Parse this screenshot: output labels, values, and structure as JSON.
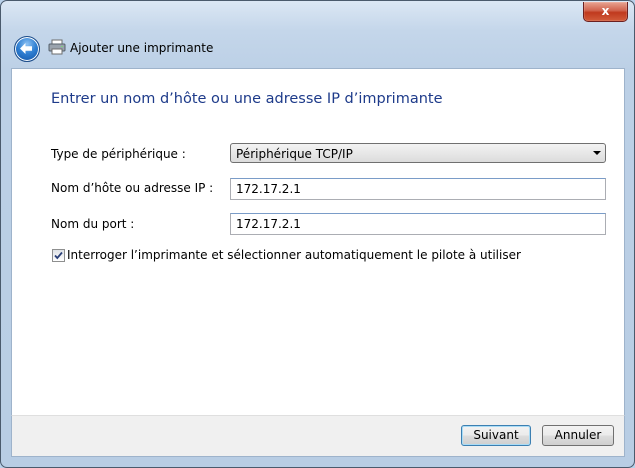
{
  "window": {
    "close_glyph": "x",
    "nav_title": "Ajouter une imprimante"
  },
  "page": {
    "heading": "Entrer un nom d’hôte ou une adresse IP d’imprimante",
    "device_type_label": "Type de périphérique :",
    "device_type_value": "Périphérique TCP/IP",
    "hostname_label": "Nom d’hôte ou adresse IP :",
    "hostname_value": "172.17.2.1",
    "port_label": "Nom du port :",
    "port_value": "172.17.2.1",
    "auto_driver_label": "Interroger l’imprimante et sélectionner automatiquement le pilote à utiliser",
    "auto_driver_checked": true
  },
  "footer": {
    "next_label": "Suivant",
    "cancel_label": "Annuler"
  },
  "icons": {
    "back": "back-arrow-icon",
    "printer": "printer-icon",
    "close": "close-icon",
    "checkbox": "checkmark-icon"
  }
}
